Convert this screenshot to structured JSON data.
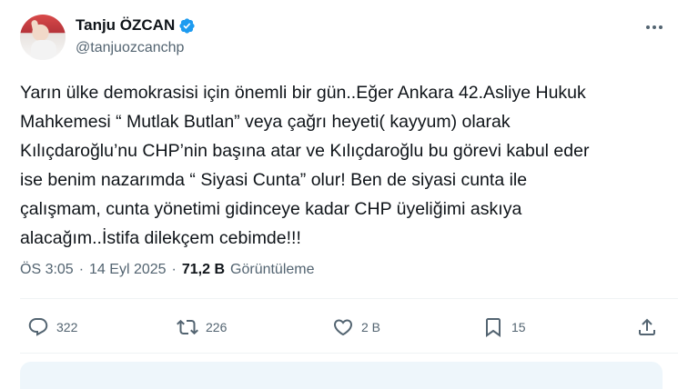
{
  "author": {
    "display_name": "Tanju ÖZCAN",
    "handle": "@tanjuozcanchp"
  },
  "tweet": {
    "text": "Yarın ülke demokrasisi için önemli bir gün..Eğer Ankara 42.Asliye Hukuk\nMahkemesi “ Mutlak Butlan” veya çağrı heyeti( kayyum) olarak\nKılıçdaroğlu’nu CHP’nin başına atar ve Kılıçdaroğlu bu görevi kabul eder\nise benim nazarımda “ Siyasi Cunta” olur! Ben de siyasi cunta ile\nçalışmam, cunta yönetimi gidinceye kadar CHP üyeliğimi askıya\nalacağım..İstifa dilekçem cebimde!!!",
    "time": "ÖS 3:05",
    "separator": "·",
    "date": "14 Eyl 2025",
    "views_count": "71,2 B",
    "views_label": "Görüntüleme"
  },
  "actions": {
    "replies": "322",
    "retweets": "226",
    "likes": "2 B",
    "bookmarks": "15"
  },
  "icons": [
    "verified-badge-icon",
    "more-icon",
    "reply-icon",
    "retweet-icon",
    "like-icon",
    "bookmark-icon",
    "share-icon"
  ],
  "colors": {
    "verified": "#1d9bf0",
    "muted": "#536471",
    "text": "#0f1419"
  }
}
